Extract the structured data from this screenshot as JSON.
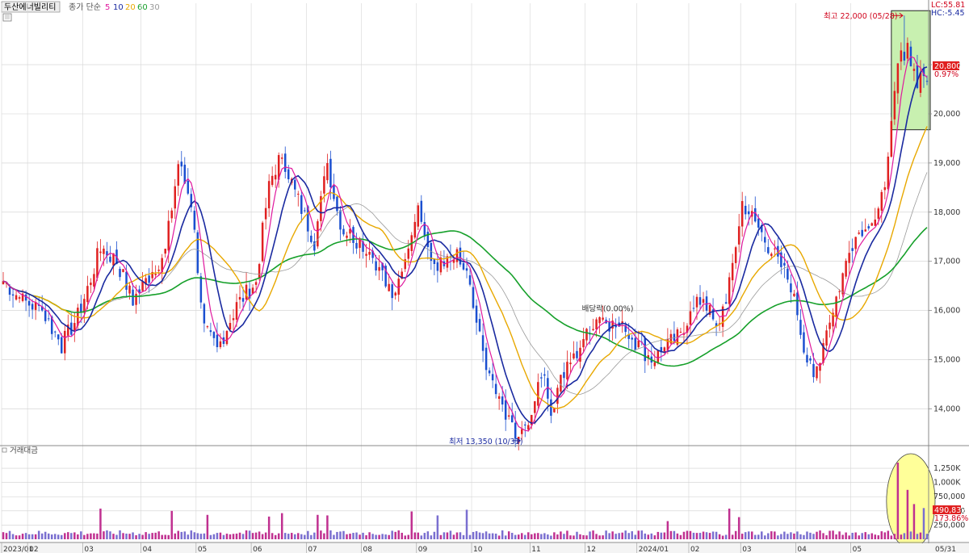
{
  "header": {
    "title": "두산에너빌리티",
    "ma_label": "종가 단순",
    "ma_periods": [
      {
        "label": "5",
        "color": "#e0199e"
      },
      {
        "label": "10",
        "color": "#1a2aa0"
      },
      {
        "label": "20",
        "color": "#e8a800"
      },
      {
        "label": "60",
        "color": "#16a02a"
      },
      {
        "label": "30",
        "color": "#999999"
      }
    ]
  },
  "right_labels": {
    "lc": "LC:55.81",
    "hc": "HC:-5.45",
    "price_tag": "20,800",
    "change_tag": "0.97%",
    "volume_tag": "490,832",
    "volume_pct": "173.86%"
  },
  "annotations": {
    "high": "최고 22,000 (05/28)",
    "low": "최저 13,350 (10/31)",
    "dividend": "배당락(0.00%)"
  },
  "volume_panel": {
    "title": "거래대금"
  },
  "chart_data": {
    "type": "candlestick",
    "price_axis": {
      "ticks": [
        "21,000",
        "20,000",
        "19,000",
        "18,000",
        "17,000",
        "16,000",
        "15,000",
        "14,000"
      ],
      "tick_values": [
        21000,
        20000,
        19000,
        18000,
        17000,
        16000,
        15000,
        14000
      ],
      "range": [
        13250,
        22250
      ]
    },
    "volume_axis": {
      "ticks": [
        "1,250K",
        "1,000K",
        "750,000",
        "500,000",
        "250,000"
      ],
      "tick_values": [
        1250,
        1000,
        750,
        500,
        250
      ],
      "range": [
        0,
        1450
      ]
    },
    "x_axis": {
      "labels": [
        "2023/01",
        "02",
        "03",
        "04",
        "05",
        "06",
        "07",
        "08",
        "09",
        "10",
        "11",
        "12",
        "2024/01",
        "02",
        "03",
        "04",
        "05",
        "05/31"
      ],
      "label_index": [
        0,
        8,
        25,
        43,
        60,
        77,
        94,
        111,
        128,
        145,
        163,
        180,
        196,
        212,
        228,
        245,
        262,
        285
      ]
    },
    "n_bars": 286,
    "anchors": [
      [
        0,
        16600
      ],
      [
        6,
        16200
      ],
      [
        12,
        16000
      ],
      [
        18,
        15300
      ],
      [
        24,
        16000
      ],
      [
        30,
        17300
      ],
      [
        35,
        17000
      ],
      [
        40,
        16200
      ],
      [
        46,
        16800
      ],
      [
        50,
        17200
      ],
      [
        54,
        19000
      ],
      [
        58,
        18200
      ],
      [
        62,
        15600
      ],
      [
        66,
        15200
      ],
      [
        72,
        16100
      ],
      [
        78,
        16600
      ],
      [
        82,
        18600
      ],
      [
        86,
        19200
      ],
      [
        90,
        18400
      ],
      [
        96,
        17400
      ],
      [
        100,
        19000
      ],
      [
        104,
        17700
      ],
      [
        108,
        17500
      ],
      [
        112,
        17300
      ],
      [
        116,
        16900
      ],
      [
        120,
        16200
      ],
      [
        124,
        17200
      ],
      [
        128,
        18100
      ],
      [
        132,
        17000
      ],
      [
        136,
        16900
      ],
      [
        140,
        17100
      ],
      [
        143,
        16700
      ],
      [
        146,
        15700
      ],
      [
        150,
        14700
      ],
      [
        155,
        13800
      ],
      [
        160,
        13400
      ],
      [
        163,
        14000
      ],
      [
        166,
        14800
      ],
      [
        169,
        13900
      ],
      [
        172,
        14600
      ],
      [
        176,
        15000
      ],
      [
        180,
        15600
      ],
      [
        184,
        15900
      ],
      [
        188,
        15700
      ],
      [
        192,
        15600
      ],
      [
        196,
        15300
      ],
      [
        200,
        15000
      ],
      [
        204,
        15200
      ],
      [
        208,
        15500
      ],
      [
        212,
        15900
      ],
      [
        216,
        16300
      ],
      [
        220,
        15600
      ],
      [
        224,
        16500
      ],
      [
        228,
        18200
      ],
      [
        232,
        17800
      ],
      [
        236,
        17300
      ],
      [
        240,
        16900
      ],
      [
        244,
        16400
      ],
      [
        247,
        15200
      ],
      [
        250,
        14600
      ],
      [
        254,
        15600
      ],
      [
        258,
        16500
      ],
      [
        262,
        17400
      ],
      [
        266,
        17800
      ],
      [
        270,
        17900
      ],
      [
        273,
        19000
      ],
      [
        276,
        21000
      ],
      [
        279,
        21400
      ],
      [
        282,
        20600
      ],
      [
        285,
        20800
      ]
    ],
    "high_point": {
      "index": 278,
      "value": 22000
    },
    "low_point": {
      "index": 160,
      "value": 13350
    },
    "dividend_point": {
      "index": 186,
      "value": 16050
    },
    "vol_base": 105,
    "vol_spikes": [
      [
        30,
        540
      ],
      [
        52,
        500
      ],
      [
        63,
        430
      ],
      [
        82,
        400
      ],
      [
        86,
        460
      ],
      [
        97,
        430
      ],
      [
        100,
        420
      ],
      [
        126,
        490
      ],
      [
        134,
        420
      ],
      [
        143,
        520
      ],
      [
        205,
        320
      ],
      [
        224,
        540
      ],
      [
        227,
        390
      ],
      [
        276,
        1350
      ],
      [
        279,
        870
      ],
      [
        281,
        620
      ],
      [
        284,
        550
      ]
    ],
    "highlight": {
      "start": 275,
      "end": 286
    }
  }
}
